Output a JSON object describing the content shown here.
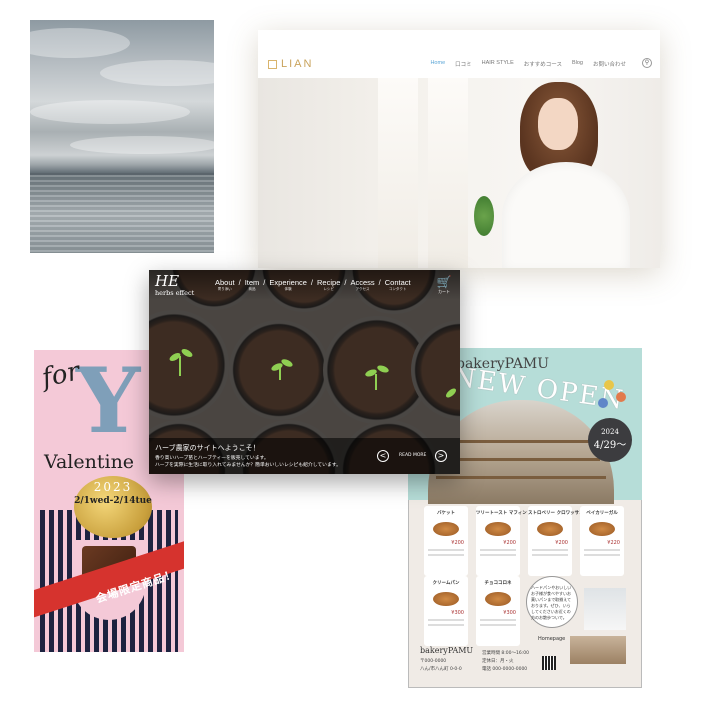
{
  "lian": {
    "logo": "LIAN",
    "menu": [
      "Home",
      "口コミ",
      "HAIR STYLE",
      "おすすめコース",
      "Blog",
      "お問い合わせ"
    ],
    "search_icon": "search-icon"
  },
  "herbs": {
    "logo_mark": "HE",
    "logo_text": "herbs effect",
    "nav": [
      {
        "label": "About",
        "sub": "寄り添い"
      },
      {
        "label": "Item",
        "sub": "商品"
      },
      {
        "label": "Experience",
        "sub": "体験"
      },
      {
        "label": "Recipe",
        "sub": "レシピ"
      },
      {
        "label": "Access",
        "sub": "アクセス"
      },
      {
        "label": "Contact",
        "sub": "コンタクト"
      }
    ],
    "cart_label": "カート",
    "caption_title": "ハーブ農家のサイトへようこそ！",
    "caption_line1": "香り高いハーブ苗とハーブティーを販売しています。",
    "caption_line2": "ハーブを実際に生活に取り入れてみませんか？簡単おいしいレシピも紹介しています。",
    "read_more": "READ MORE",
    "arrow_left": "<",
    "arrow_right": ">"
  },
  "valentine": {
    "for": "for",
    "big_letter": "Y",
    "title": "Valentine",
    "year": "2023",
    "dates": "2/1wed-2/14tue",
    "banner": "会場限定商品！"
  },
  "bakery": {
    "brand": "bakeryPAMU",
    "headline": "NEW OPEN",
    "date_year": "2024",
    "date_day": "4/29〜",
    "items": [
      {
        "name": "バケット",
        "price": "¥200"
      },
      {
        "name": "ツリートースト\nマフィン",
        "price": "¥200"
      },
      {
        "name": "ストロベリー\nクロワッサン",
        "price": "¥200"
      },
      {
        "name": "ベイカリーガル",
        "price": "¥220"
      },
      {
        "name": "クリームパン",
        "price": "¥300"
      },
      {
        "name": "チョココロネ",
        "price": "¥300"
      }
    ],
    "bubble": "ハードパンやおいしいお子様が食べやすいお菓いパンまで取揃えております。ぜひ、いらしてくださいお近くの方のお散歩ついで。",
    "homepage": "Homepage",
    "footer_name": "bakeryPAMU",
    "footer_tel": "〒000-0000",
    "footer_addr": "八ん/市八ん町 0-0-0",
    "footer_hours": "営業時間 8:00〜16:00\n定休日：月・火\n電話 000-0000-0000"
  },
  "colors": {
    "lian_accent": "#c9a35c",
    "lian_active": "#5aa5d6",
    "valentine_bg": "#f4c9d7",
    "valentine_ribbon": "#d6332e",
    "bakery_mint": "#b6ddd8"
  }
}
